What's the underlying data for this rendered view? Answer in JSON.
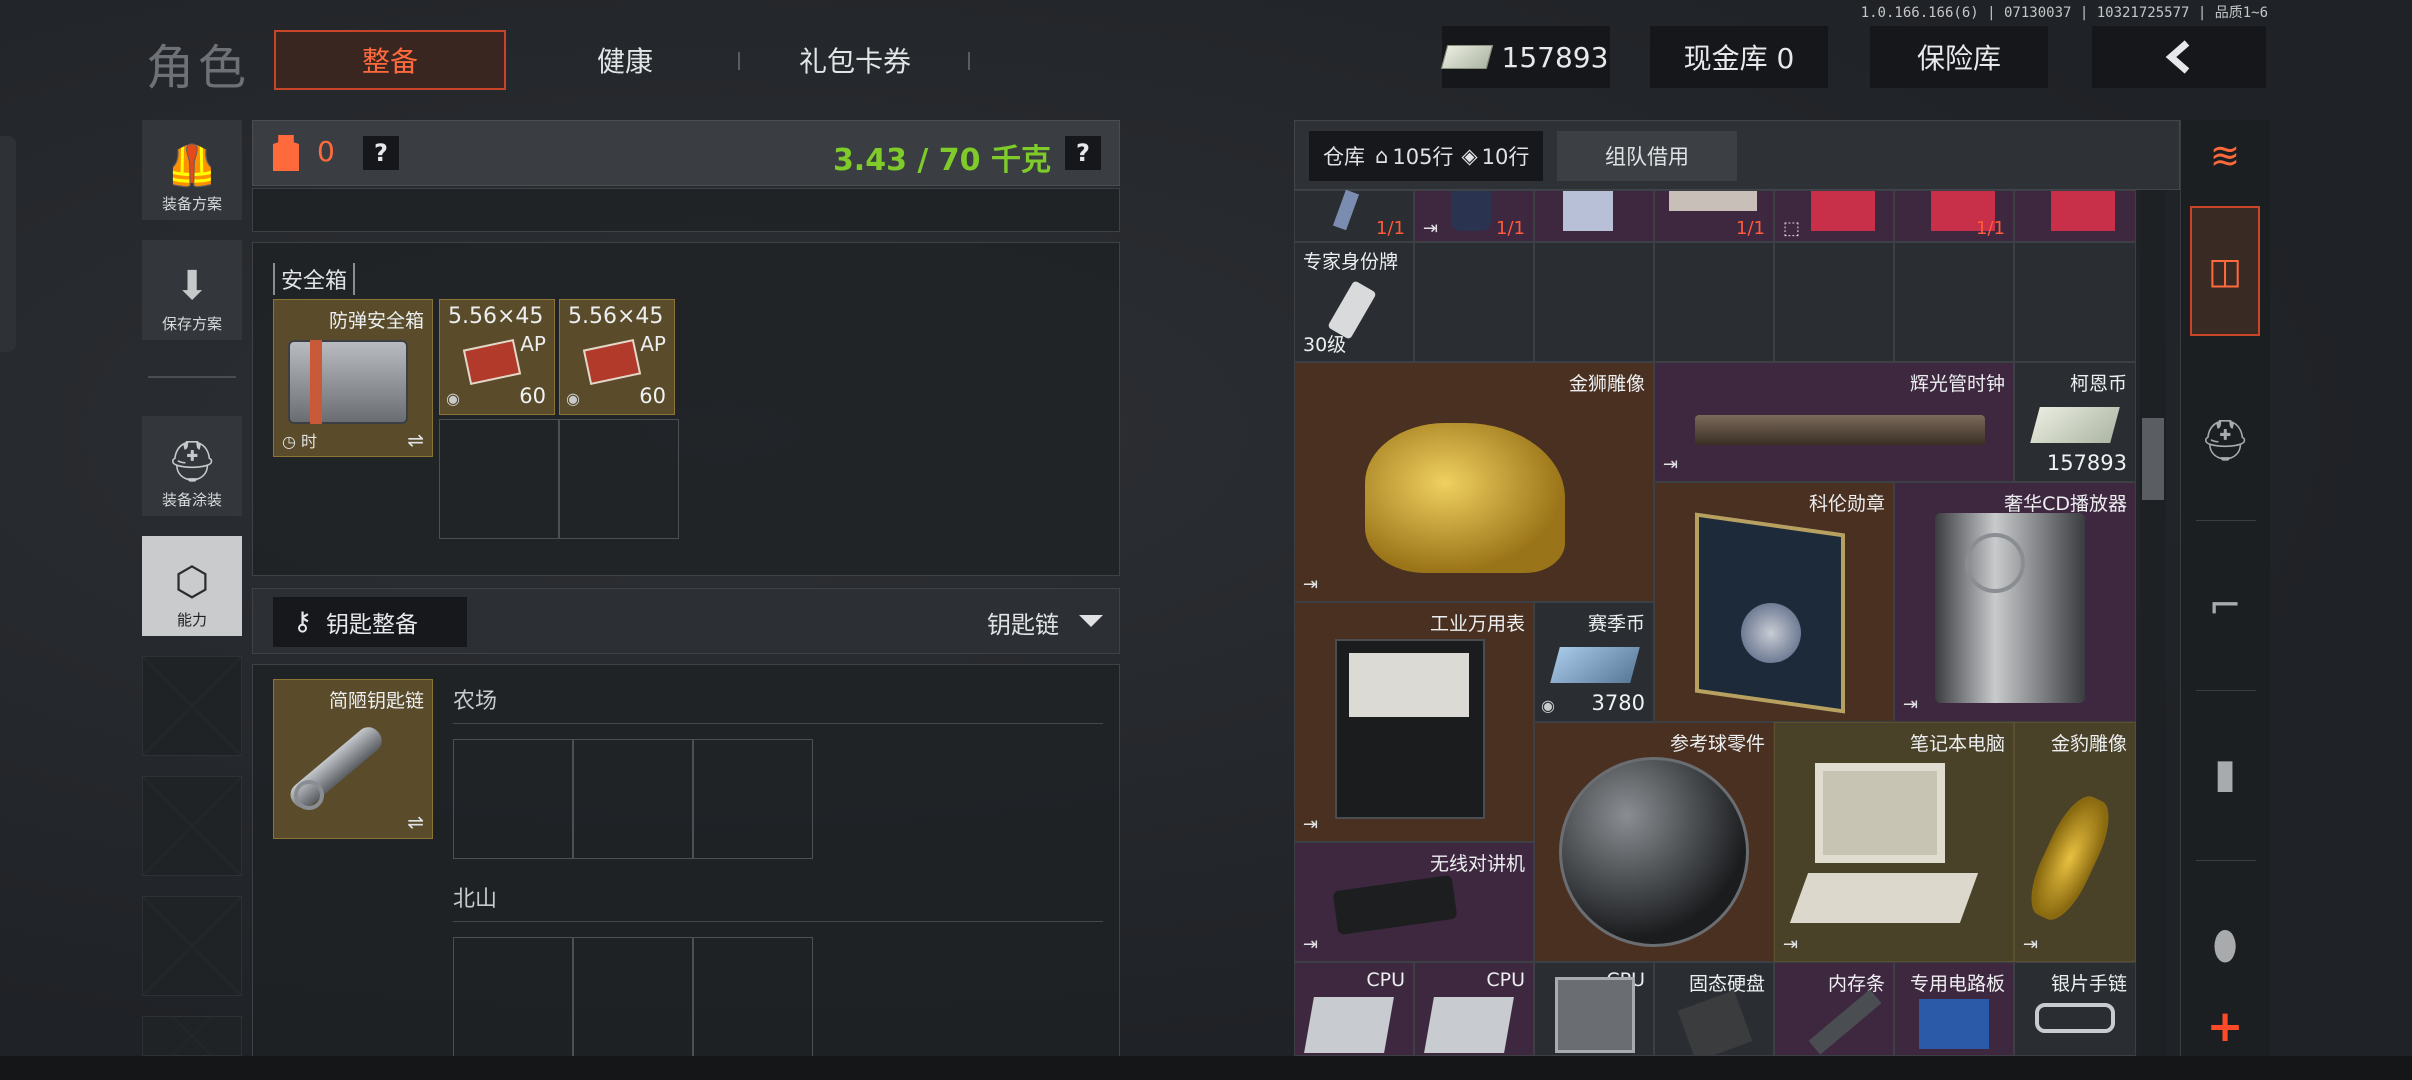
{
  "header": {
    "title": "角色",
    "tabs": [
      {
        "label": "整备",
        "active": true
      },
      {
        "label": "健康",
        "active": false
      },
      {
        "label": "礼包卡券",
        "active": false
      }
    ],
    "version": "1.0.166.166(6) | 07130037 | 10321725577 | 品质1~6",
    "money": "157893",
    "cash_vault": "现金库 0",
    "insurance": "保险库",
    "back_icon": "chevron-left-icon"
  },
  "sidebar": {
    "items": [
      {
        "label": "装备方案",
        "icon": "vest-icon"
      },
      {
        "label": "保存方案",
        "icon": "download-icon"
      },
      {
        "label": "装备涂装",
        "icon": "helmet-icon"
      },
      {
        "label": "能力",
        "icon": "ability-icon",
        "active": true
      }
    ]
  },
  "loadout": {
    "armor_count": "0",
    "help": "?",
    "weight": "3.43 / 70 千克",
    "safebox_label": "安全箱",
    "safebox_items": [
      {
        "name": "防弹安全箱",
        "sub": "时"
      },
      {
        "name": "5.56×45",
        "tag": "AP",
        "count": "60"
      },
      {
        "name": "5.56×45",
        "tag": "AP",
        "count": "60"
      }
    ],
    "key_section": "钥匙整备",
    "key_dropdown": "钥匙链",
    "keychain_item": "简陋钥匙链",
    "maps": [
      "农场",
      "北山"
    ]
  },
  "warehouse": {
    "label": "仓库",
    "rows": "105行",
    "cols": "10行",
    "team_borrow": "组队借用",
    "top_row_counts": [
      "1/1",
      "1/1",
      "1/1",
      "1/1"
    ],
    "items": [
      {
        "name": "专家身份牌",
        "count": "30级"
      },
      {
        "name": "金狮雕像"
      },
      {
        "name": "辉光管时钟"
      },
      {
        "name": "柯恩币",
        "count": "157893"
      },
      {
        "name": "科伦勋章"
      },
      {
        "name": "奢华CD播放器"
      },
      {
        "name": "工业万用表"
      },
      {
        "name": "赛季币",
        "count": "3780"
      },
      {
        "name": "参考球零件"
      },
      {
        "name": "笔记本电脑"
      },
      {
        "name": "金豹雕像"
      },
      {
        "name": "无线对讲机"
      },
      {
        "name": "CPU"
      },
      {
        "name": "CPU"
      },
      {
        "name": "CPU"
      },
      {
        "name": "固态硬盘"
      },
      {
        "name": "内存条"
      },
      {
        "name": "专用电路板"
      },
      {
        "name": "银片手链"
      }
    ]
  },
  "rail": {
    "icons": [
      "stack-refresh-icon",
      "layers-icon",
      "helmet-icon",
      "rifle-icon",
      "magazine-icon",
      "bullet-icon",
      "plus-icon"
    ]
  },
  "colors": {
    "accent": "#ff6a3d",
    "weight_green": "#7ecb2a"
  }
}
